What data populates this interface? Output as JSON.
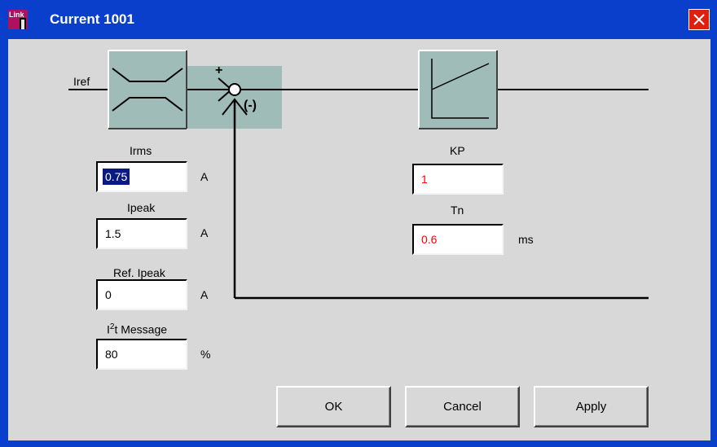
{
  "window": {
    "title": "Current 1001",
    "icon_label": "Link"
  },
  "diagram": {
    "input_label": "Iref",
    "plus_sign": "+",
    "minus_sign": "(-)"
  },
  "fields": {
    "irms": {
      "label": "Irms",
      "value": "0.75",
      "unit": "A"
    },
    "ipeak": {
      "label": "Ipeak",
      "value": "1.5",
      "unit": "A"
    },
    "ref_ipeak": {
      "label": "Ref. Ipeak",
      "value": "0",
      "unit": "A"
    },
    "i2t": {
      "label_base": "I",
      "label_sup": "2",
      "label_rest": "t Message",
      "value": "80",
      "unit": "%"
    },
    "kp": {
      "label": "KP",
      "value": "1"
    },
    "tn": {
      "label": "Tn",
      "value": "0.6",
      "unit": "ms"
    }
  },
  "buttons": {
    "ok": "OK",
    "cancel": "Cancel",
    "apply": "Apply"
  },
  "colors": {
    "titlebar": "#0a3fcc",
    "block_fill": "#9fbcb8",
    "value_text_red": "#ff0000",
    "close_button": "#e0200e"
  }
}
